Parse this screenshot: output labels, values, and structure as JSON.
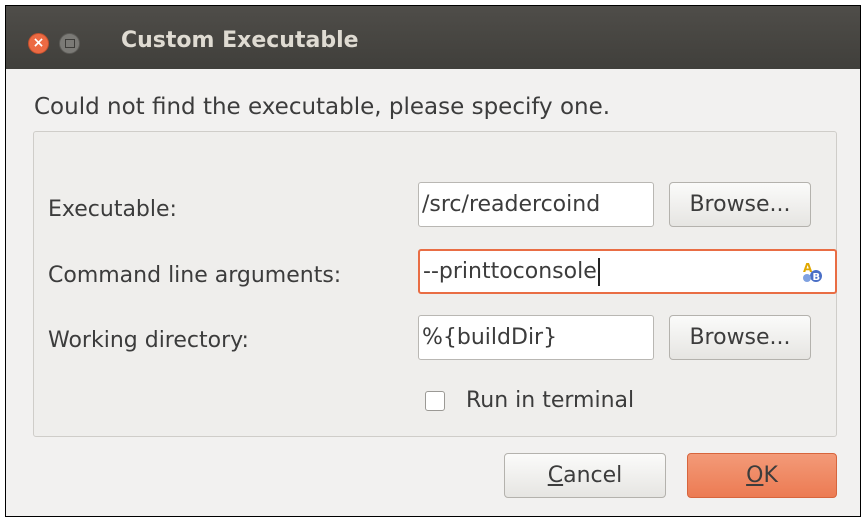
{
  "window": {
    "title": "Custom Executable"
  },
  "message": "Could not find the executable, please specify one.",
  "form": {
    "executable": {
      "label": "Executable:",
      "value": "/src/readercoind",
      "browse_label": "Browse..."
    },
    "arguments": {
      "label": "Command line arguments:",
      "value": "--printtoconsole",
      "icon": "text-completion-icon"
    },
    "working_dir": {
      "label": "Working directory:",
      "value": "%{buildDir}",
      "browse_label": "Browse..."
    },
    "run_in_terminal": {
      "label": "Run in terminal",
      "checked": false
    }
  },
  "buttons": {
    "cancel_prefix": "",
    "cancel_mnemonic": "C",
    "cancel_rest": "ancel",
    "ok_mnemonic": "O",
    "ok_rest": "K"
  },
  "colors": {
    "titlebar": "#45433f",
    "close": "#ec6a43",
    "ok": "#ec7b53",
    "focus": "#e96d44"
  }
}
